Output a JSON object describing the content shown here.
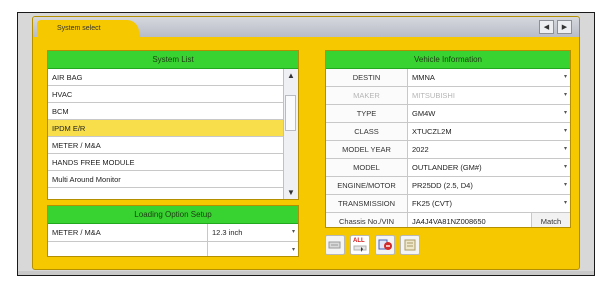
{
  "window": {
    "title": "System select"
  },
  "nav": {
    "prev_glyph": "◀",
    "next_glyph": "▶"
  },
  "system_list": {
    "header": "System List",
    "items": [
      {
        "label": "AIR BAG",
        "selected": false
      },
      {
        "label": "HVAC",
        "selected": false
      },
      {
        "label": "BCM",
        "selected": false
      },
      {
        "label": "IPDM E/R",
        "selected": true
      },
      {
        "label": "METER / M&A",
        "selected": false
      },
      {
        "label": "HANDS FREE MODULE",
        "selected": false
      },
      {
        "label": "Multi Around Monitor",
        "selected": false
      }
    ],
    "scroll_up_glyph": "▲",
    "scroll_down_glyph": "▼"
  },
  "loading_option": {
    "header": "Loading Option Setup",
    "rows": [
      {
        "item": "METER / M&A",
        "value": "12.3 inch"
      },
      {
        "item": "",
        "value": ""
      }
    ]
  },
  "vehicle_info": {
    "header": "Vehicle Information",
    "rows": [
      {
        "label": "DESTIN",
        "value": "MMNA",
        "disabled": false
      },
      {
        "label": "MAKER",
        "value": "MITSUBISHI",
        "disabled": true
      },
      {
        "label": "TYPE",
        "value": "GM4W",
        "disabled": false
      },
      {
        "label": "CLASS",
        "value": "XTUCZL2M",
        "disabled": false
      },
      {
        "label": "MODEL YEAR",
        "value": "2022",
        "disabled": false
      },
      {
        "label": "MODEL",
        "value": "OUTLANDER (GM#)",
        "disabled": false
      },
      {
        "label": "ENGINE/MOTOR",
        "value": "PR25DD (2.5, D4)",
        "disabled": false
      },
      {
        "label": "TRANSMISSION",
        "value": "FK25 (CVT)",
        "disabled": false
      }
    ],
    "vin_label": "Chassis No./VIN",
    "vin_value": "JA4J4VA81NZ008650",
    "match_label": "Match",
    "dropdown_glyph": "▾"
  },
  "toolbar": {
    "all_label": "ALL",
    "icons": [
      "clear-icon",
      "all-systems-icon",
      "transfer-icon",
      "document-icon"
    ]
  },
  "colors": {
    "window_yellow": "#f5c800",
    "header_green": "#39d331",
    "selected_row": "#f7de4a"
  }
}
